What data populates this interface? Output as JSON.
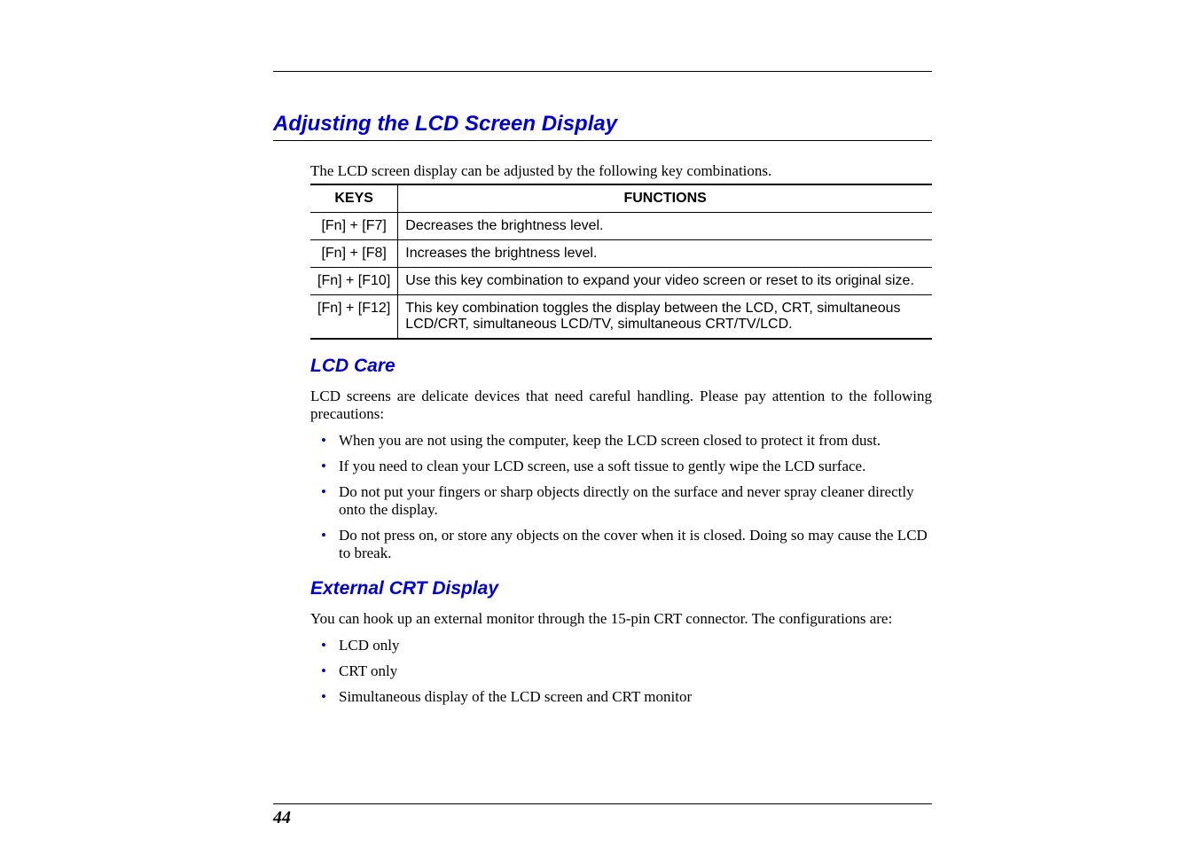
{
  "heading": "Adjusting the LCD Screen Display",
  "intro": "The LCD screen display can be adjusted by the following key combinations.",
  "table": {
    "headers": {
      "keys": "KEYS",
      "func": "FUNCTIONS"
    },
    "rows": [
      {
        "keys": "[Fn] + [F7]",
        "func": "Decreases the brightness level."
      },
      {
        "keys": "[Fn] + [F8]",
        "func": "Increases the brightness level."
      },
      {
        "keys": "[Fn] + [F10]",
        "func": "Use this key combination to expand your video screen or reset to its original size."
      },
      {
        "keys": "[Fn] + [F12]",
        "func": "This key combination toggles the display between the LCD, CRT, simultaneous LCD/CRT, simultaneous LCD/TV, simultaneous CRT/TV/LCD."
      }
    ]
  },
  "section1": {
    "title": "LCD Care",
    "para": "LCD screens are delicate devices that need careful handling.  Please pay attention to the following precautions:",
    "bullets": [
      "When you are not using the computer, keep the LCD screen closed to protect it from dust.",
      "If you need to clean your LCD screen, use a soft tissue to gently wipe the LCD surface.",
      "Do not put your fingers or sharp objects directly on the surface and never spray cleaner directly onto the display.",
      "Do not press on, or store any objects on the cover when it is closed.  Doing so may cause the LCD to break."
    ]
  },
  "section2": {
    "title": "External CRT Display",
    "para": "You can hook up an external monitor through the 15-pin CRT connector.  The configurations are:",
    "bullets": [
      "LCD only",
      "CRT only",
      "Simultaneous display of the LCD screen and CRT monitor"
    ]
  },
  "page_number": "44"
}
